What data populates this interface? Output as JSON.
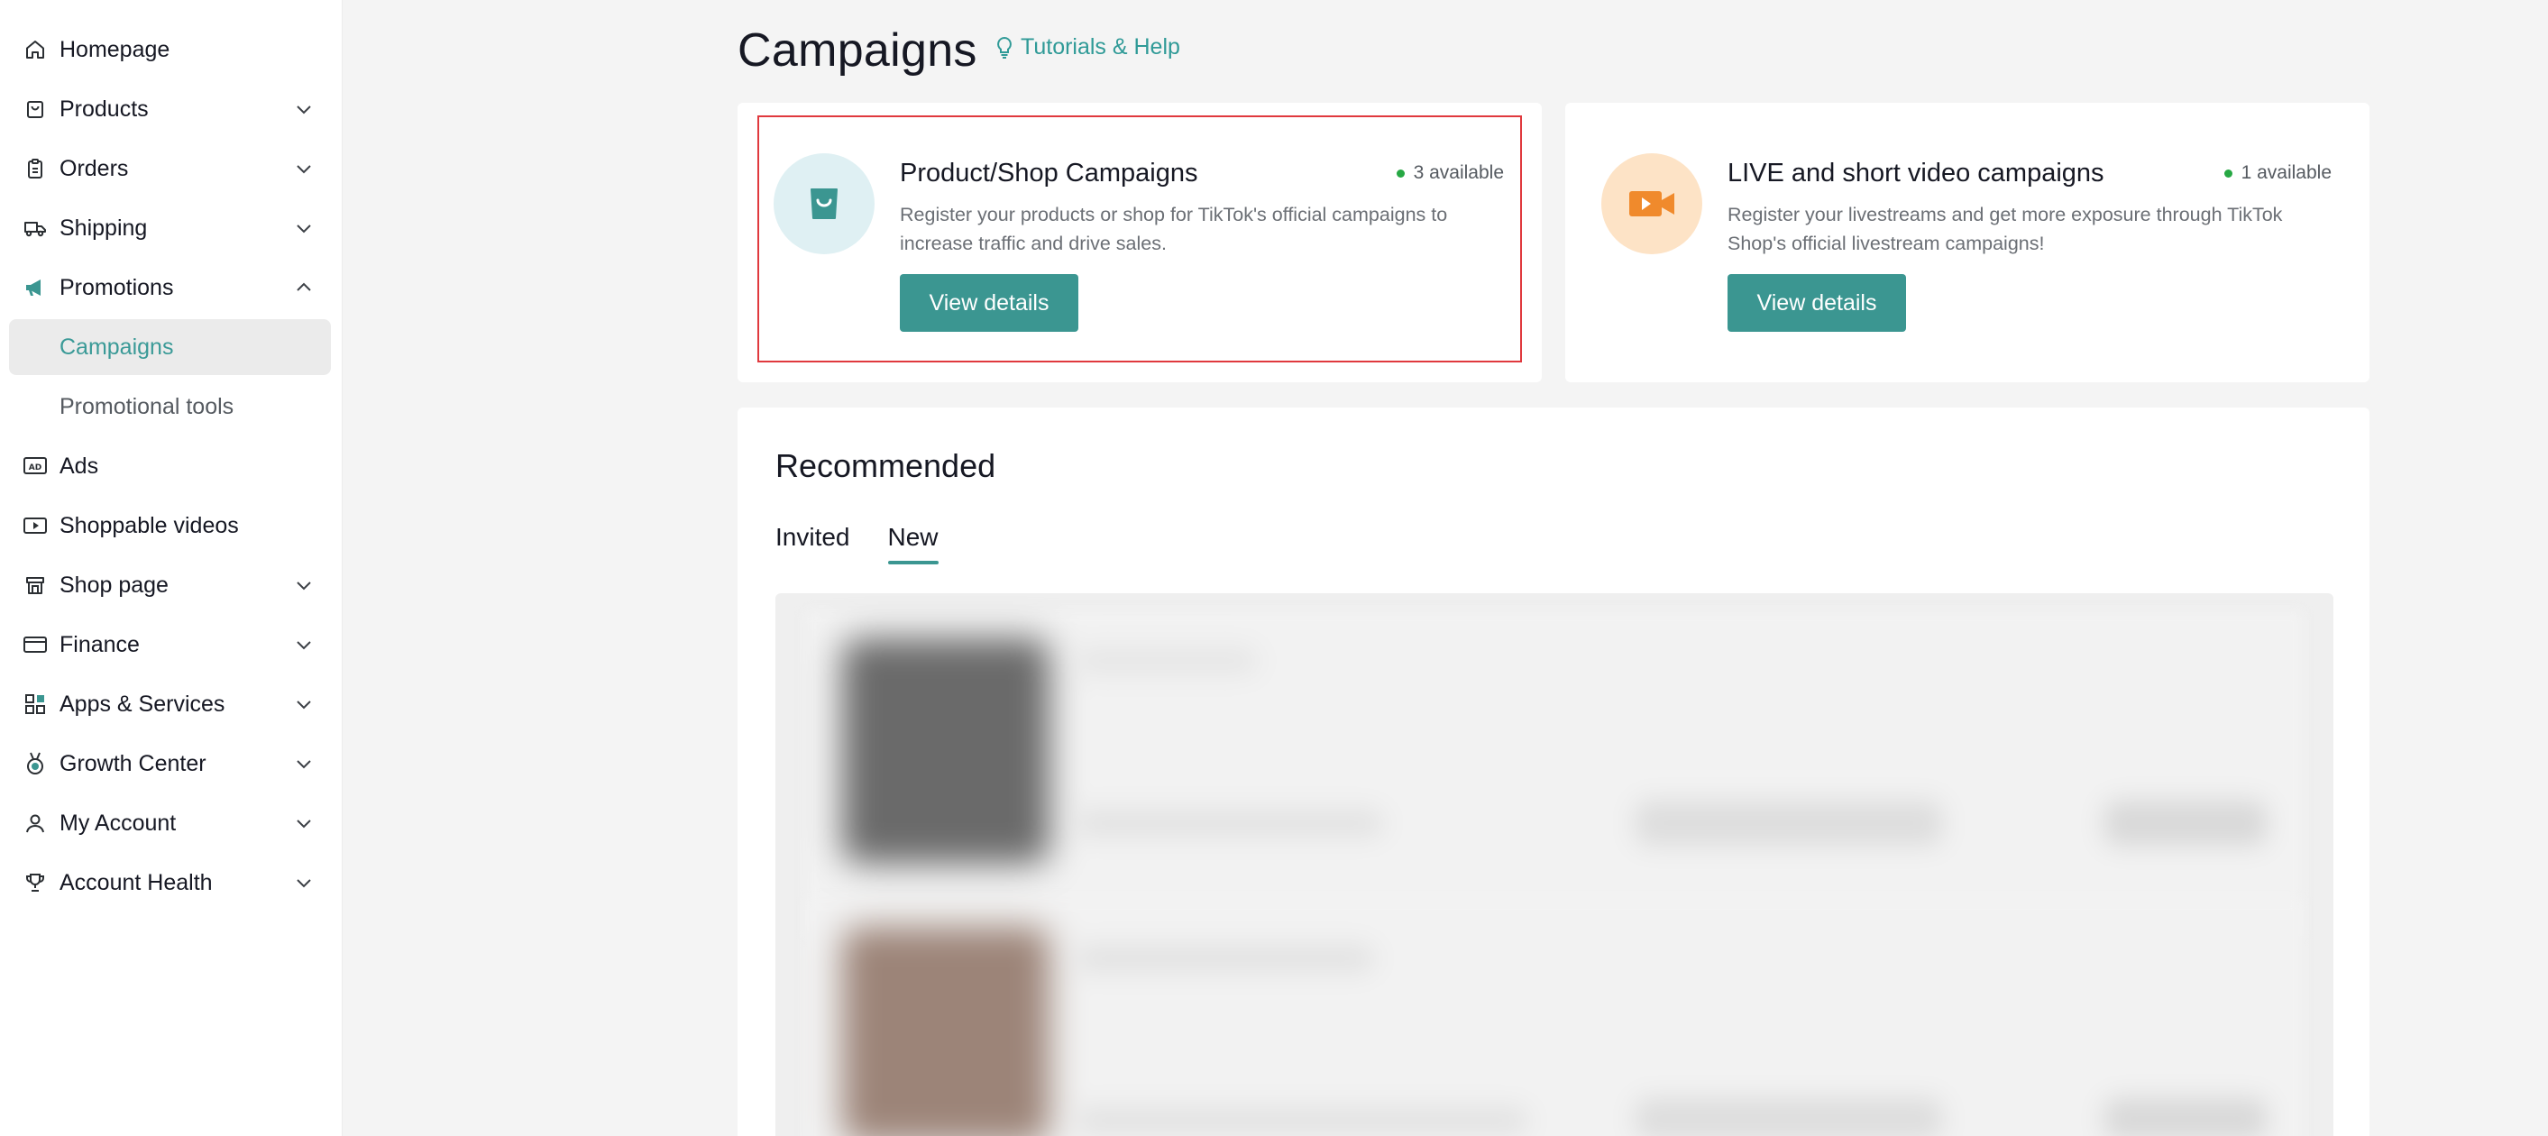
{
  "sidebar": {
    "items": [
      {
        "label": "Homepage",
        "icon": "home-icon",
        "chevron": "none"
      },
      {
        "label": "Products",
        "icon": "product-bag-icon",
        "chevron": "down"
      },
      {
        "label": "Orders",
        "icon": "clipboard-icon",
        "chevron": "down"
      },
      {
        "label": "Shipping",
        "icon": "truck-icon",
        "chevron": "down"
      },
      {
        "label": "Promotions",
        "icon": "megaphone-icon",
        "chevron": "up"
      },
      {
        "label": "Campaigns",
        "sub": true,
        "active": true
      },
      {
        "label": "Promotional tools",
        "sub": true
      },
      {
        "label": "Ads",
        "icon": "ad-icon",
        "chevron": "none"
      },
      {
        "label": "Shoppable videos",
        "icon": "video-icon",
        "chevron": "none"
      },
      {
        "label": "Shop page",
        "icon": "shop-icon",
        "chevron": "down"
      },
      {
        "label": "Finance",
        "icon": "card-icon",
        "chevron": "down"
      },
      {
        "label": "Apps & Services",
        "icon": "apps-icon",
        "chevron": "down"
      },
      {
        "label": "Growth Center",
        "icon": "medal-icon",
        "chevron": "down"
      },
      {
        "label": "My Account",
        "icon": "user-icon",
        "chevron": "down"
      },
      {
        "label": "Account Health",
        "icon": "trophy-icon",
        "chevron": "down"
      }
    ]
  },
  "header": {
    "title": "Campaigns",
    "help_label": "Tutorials & Help"
  },
  "campaign_cards": [
    {
      "title": "Product/Shop Campaigns",
      "available": "3 available",
      "description": "Register your products or shop for TikTok's official campaigns to increase traffic and drive sales.",
      "button": "View details"
    },
    {
      "title": "LIVE and short video campaigns",
      "available": "1 available",
      "description": "Register your livestreams and get more exposure through TikTok Shop's official livestream campaigns!",
      "button": "View details"
    }
  ],
  "recommended": {
    "title": "Recommended",
    "tabs": [
      {
        "label": "Invited",
        "active": false
      },
      {
        "label": "New",
        "active": true
      }
    ]
  },
  "colors": {
    "accent": "#3b9691",
    "link": "#2f9a97",
    "available_dot": "#27a844",
    "highlight": "#e0393e",
    "shop_circle": "#dff0f3",
    "live_circle": "#fde3c6",
    "live_icon": "#f08a2c"
  }
}
